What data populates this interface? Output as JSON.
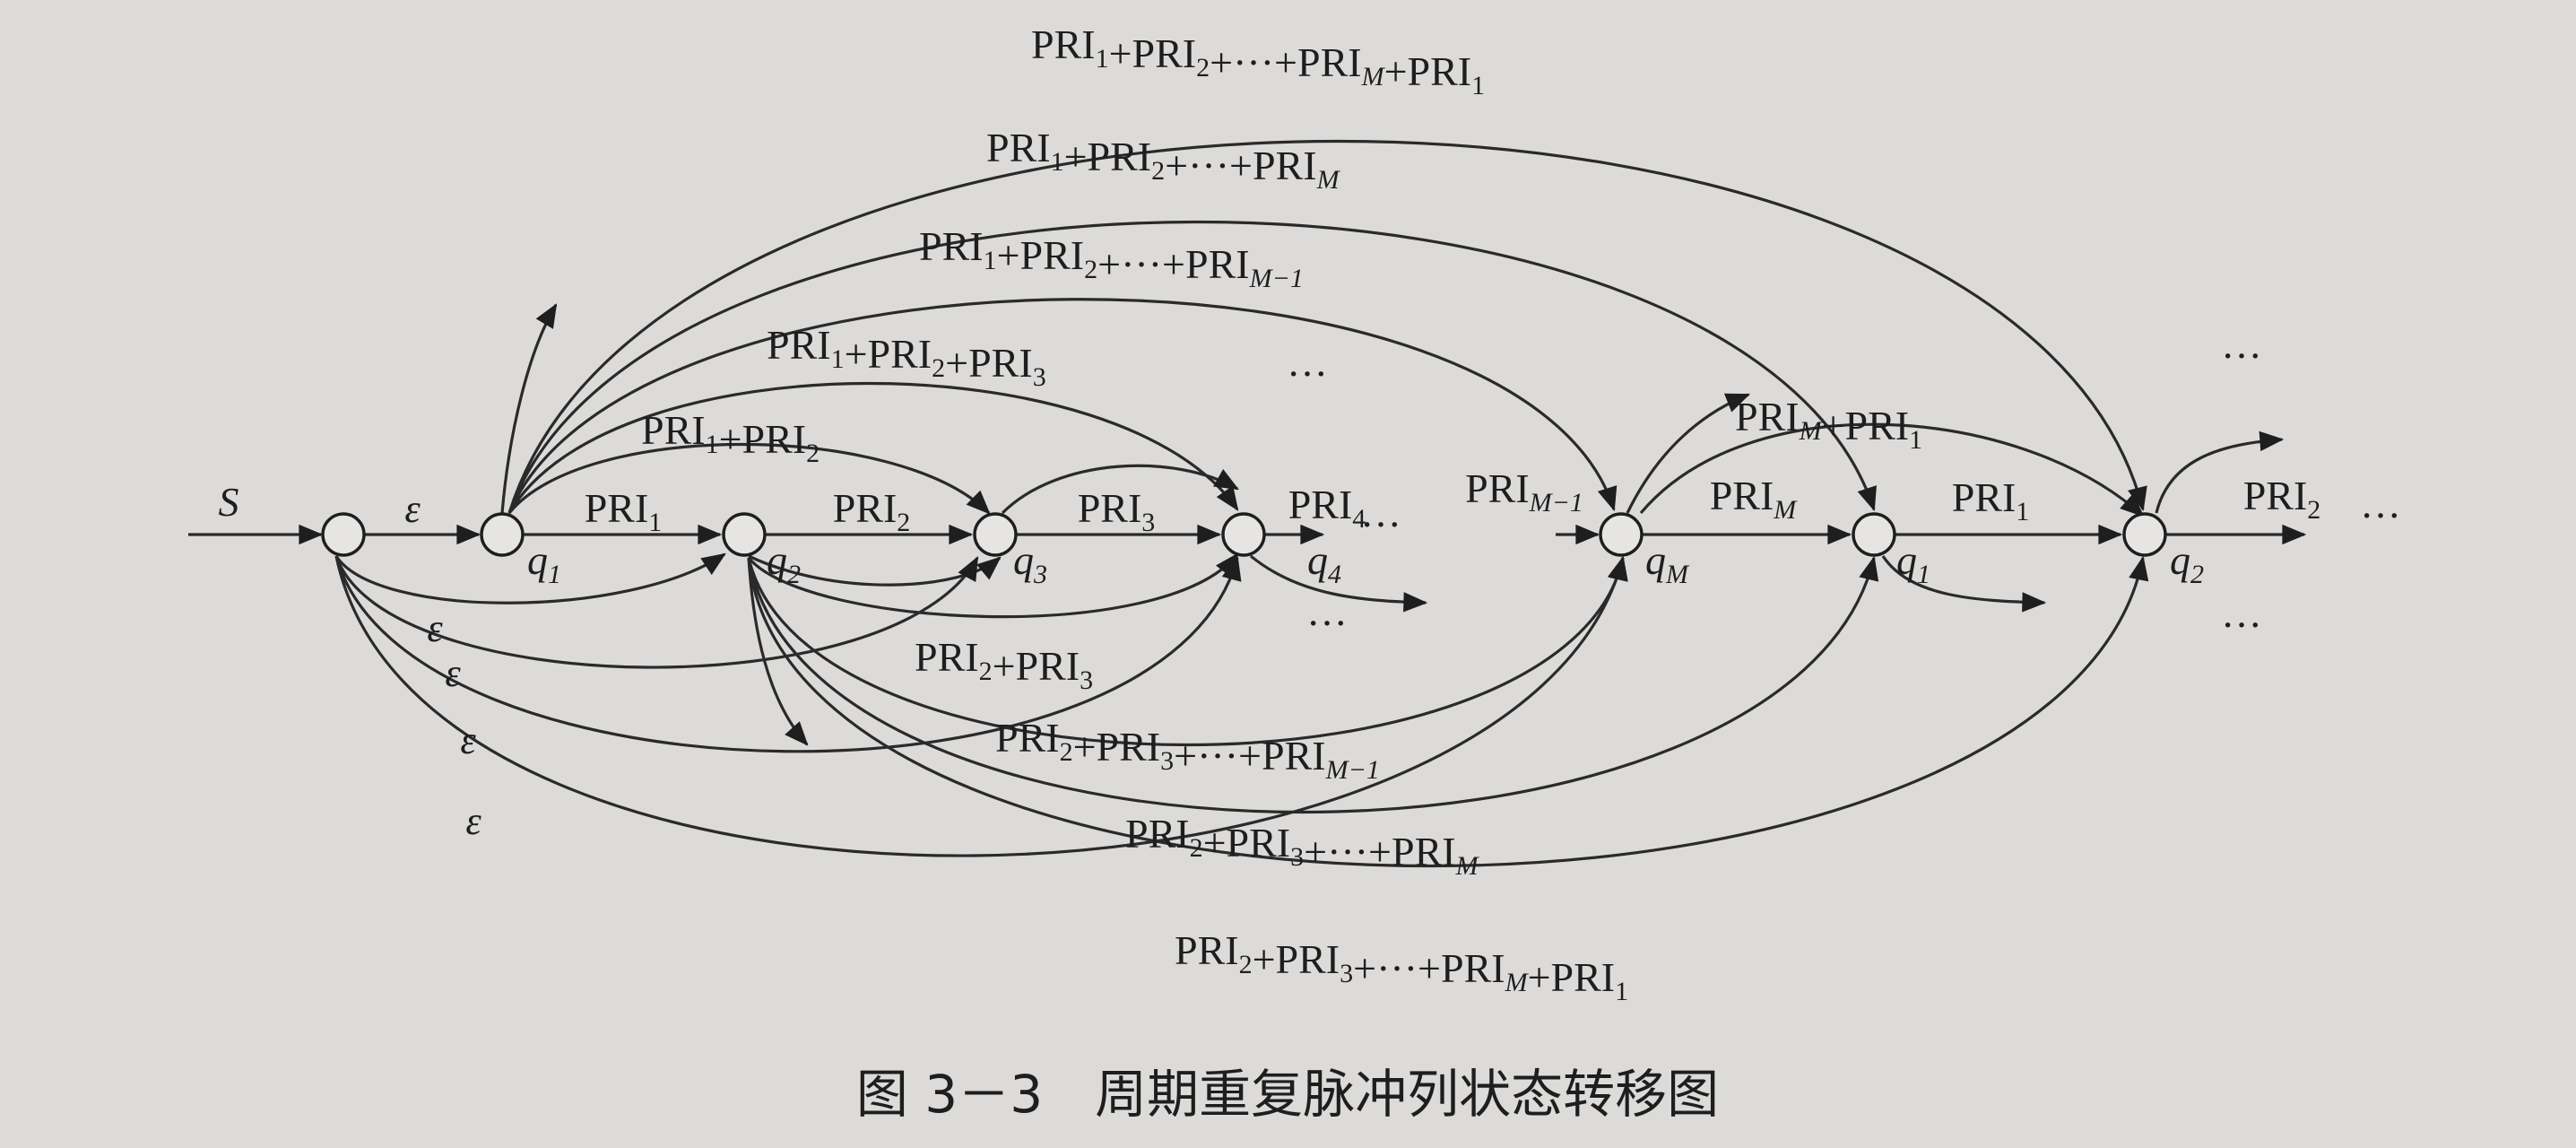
{
  "caption": "图 3－3　周期重复脉冲列状态转移图",
  "nodes": [
    {
      "id": "start",
      "label": ""
    },
    {
      "id": "q1",
      "label": "q1"
    },
    {
      "id": "q2",
      "label": "q2"
    },
    {
      "id": "q3",
      "label": "q3"
    },
    {
      "id": "q4",
      "label": "q4"
    },
    {
      "id": "qM",
      "label": "qM"
    },
    {
      "id": "q1b",
      "label": "q1"
    },
    {
      "id": "q2b",
      "label": "q2"
    }
  ],
  "edges": [
    {
      "from": "input",
      "to": "start",
      "label": "S"
    },
    {
      "from": "start",
      "to": "q1",
      "label": "ε"
    },
    {
      "from": "q1",
      "to": "q2",
      "label": "PRI1"
    },
    {
      "from": "q2",
      "to": "q3",
      "label": "PRI2"
    },
    {
      "from": "q3",
      "to": "q4",
      "label": "PRI3"
    },
    {
      "from": "q4",
      "to": "next",
      "label": "PRI4"
    },
    {
      "from": "prev",
      "to": "qM",
      "label": "PRIM−1"
    },
    {
      "from": "qM",
      "to": "q1b",
      "label": "PRIM"
    },
    {
      "from": "q1b",
      "to": "q2b",
      "label": "PRI1"
    },
    {
      "from": "q2b",
      "to": "next",
      "label": "PRI2"
    },
    {
      "from": "q1",
      "to": "q3",
      "label": "PRI1+PRI2"
    },
    {
      "from": "q1",
      "to": "q4",
      "label": "PRI1+PRI2+PRI3"
    },
    {
      "from": "q1",
      "to": "qM",
      "label": "PRI1+PRI2+···+PRIM−1"
    },
    {
      "from": "q1",
      "to": "q1b",
      "label": "PRI1+PRI2+···+PRIM"
    },
    {
      "from": "q1",
      "to": "q2b",
      "label": "PRI1+PRI2+···+PRIM+PRI1"
    },
    {
      "from": "qM",
      "to": "q2b",
      "label": "PRIM+PRI1"
    },
    {
      "from": "q2",
      "to": "q4",
      "label": "PRI2+PRI3"
    },
    {
      "from": "q2",
      "to": "qM",
      "label": "PRI2+PRI3+···+PRIM−1"
    },
    {
      "from": "q2",
      "to": "q1b",
      "label": "PRI2+PRI3+···+PRIM"
    },
    {
      "from": "q2",
      "to": "q2b",
      "label": "PRI2+PRI3+···+PRIM+PRI1"
    },
    {
      "from": "start",
      "to": "q2",
      "label": "ε"
    },
    {
      "from": "start",
      "to": "q3",
      "label": "ε"
    },
    {
      "from": "start",
      "to": "q4",
      "label": "ε"
    },
    {
      "from": "start",
      "to": "qM",
      "label": "ε"
    }
  ],
  "ellipsis": "···",
  "colors": {
    "ink": "#1e1e1e",
    "paper": "#dcdbd9"
  }
}
